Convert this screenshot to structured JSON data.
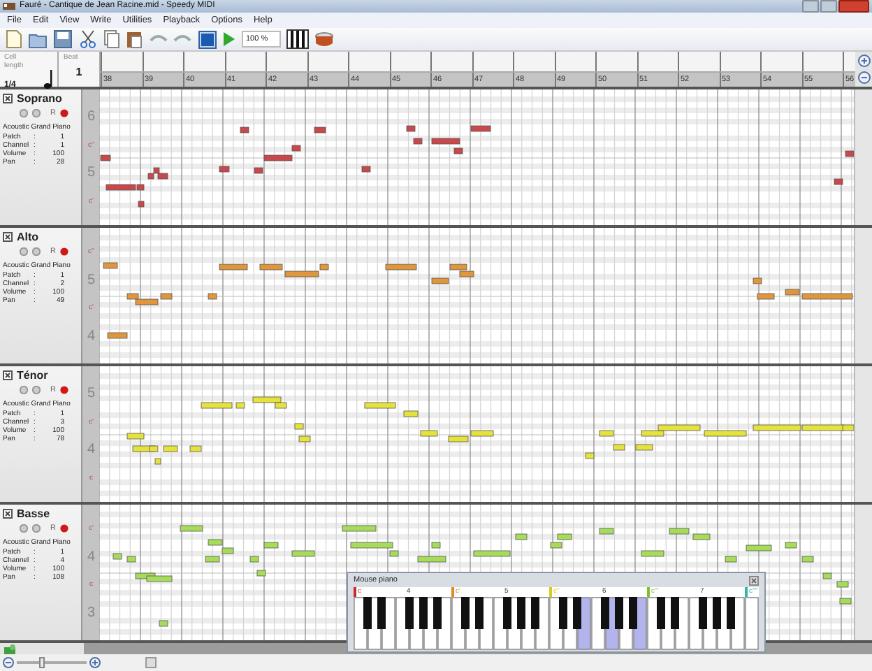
{
  "window": {
    "title": "Fauré - Cantique de Jean Racine.mid - Speedy MIDI"
  },
  "menu": [
    "File",
    "Edit",
    "View",
    "Write",
    "Utilities",
    "Playback",
    "Options",
    "Help"
  ],
  "toolbar": {
    "zoom_value": "100 %",
    "stop_pressed": true
  },
  "header": {
    "cell_label": "Cell length",
    "cell_value": "1/4",
    "beat_label": "Beat",
    "beat_value": "1"
  },
  "measures": [
    "38",
    "39",
    "40",
    "41",
    "42",
    "43",
    "44",
    "45",
    "46",
    "47",
    "48",
    "49",
    "50",
    "51",
    "52",
    "53",
    "54",
    "55",
    "56"
  ],
  "tracks": [
    {
      "name": "Soprano",
      "checked": true,
      "color": "#c8484c",
      "record_label": "R",
      "instrument": "Acoustic Grand Piano",
      "octave_labels": [
        "6",
        "c''",
        "5",
        "c'"
      ],
      "fields": [
        {
          "label": "Patch",
          "sep": ":",
          "value": "1"
        },
        {
          "label": "Channel",
          "sep": ":",
          "value": "1"
        },
        {
          "label": "Volume",
          "sep": ":",
          "value": "100"
        },
        {
          "label": "Pan",
          "sep": ":",
          "value": "28"
        }
      ]
    },
    {
      "name": "Alto",
      "checked": true,
      "color": "#e0963c",
      "record_label": "R",
      "instrument": "Acoustic Grand Piano",
      "octave_labels": [
        "c''",
        "5",
        "c'",
        "4"
      ],
      "fields": [
        {
          "label": "Patch",
          "sep": ":",
          "value": "1"
        },
        {
          "label": "Channel",
          "sep": ":",
          "value": "2"
        },
        {
          "label": "Volume",
          "sep": ":",
          "value": "100"
        },
        {
          "label": "Pan",
          "sep": ":",
          "value": "49"
        }
      ]
    },
    {
      "name": "Ténor",
      "checked": true,
      "color": "#e6e23c",
      "record_label": "R",
      "instrument": "Acoustic Grand Piano",
      "octave_labels": [
        "5",
        "c'",
        "4",
        "c"
      ],
      "fields": [
        {
          "label": "Patch",
          "sep": ":",
          "value": "1"
        },
        {
          "label": "Channel",
          "sep": ":",
          "value": "3"
        },
        {
          "label": "Volume",
          "sep": ":",
          "value": "100"
        },
        {
          "label": "Pan",
          "sep": ":",
          "value": "78"
        }
      ]
    },
    {
      "name": "Basse",
      "checked": true,
      "color": "#a6dc5a",
      "record_label": "R",
      "instrument": "Acoustic Grand Piano",
      "octave_labels": [
        "c'",
        "4",
        "c",
        "3"
      ],
      "fields": [
        {
          "label": "Patch",
          "sep": ":",
          "value": "1"
        },
        {
          "label": "Channel",
          "sep": ":",
          "value": "4"
        },
        {
          "label": "Volume",
          "sep": ":",
          "value": "100"
        },
        {
          "label": "Pan",
          "sep": ":",
          "value": "108"
        }
      ]
    }
  ],
  "mouse_piano": {
    "title": "Mouse piano",
    "labels": [
      {
        "text": "c",
        "color": "#d02828"
      },
      {
        "text": "4"
      },
      {
        "text": "c'",
        "color": "#e08a20"
      },
      {
        "text": "5"
      },
      {
        "text": "c''",
        "color": "#d8cc20"
      },
      {
        "text": "6"
      },
      {
        "text": "c'''",
        "color": "#80c030"
      },
      {
        "text": "7"
      },
      {
        "text": "c''''",
        "color": "#30b8a8"
      }
    ],
    "white_keys": [
      {
        "pressed": false
      },
      {
        "pressed": false
      },
      {
        "pressed": false
      },
      {
        "pressed": false
      },
      {
        "pressed": false
      },
      {
        "pressed": false
      },
      {
        "pressed": false
      },
      {
        "pressed": false
      },
      {
        "pressed": false
      },
      {
        "pressed": false
      },
      {
        "pressed": false
      },
      {
        "pressed": false
      },
      {
        "pressed": false
      },
      {
        "pressed": false
      },
      {
        "pressed": false
      },
      {
        "pressed": false
      },
      {
        "pressed": true
      },
      {
        "pressed": false
      },
      {
        "pressed": true
      },
      {
        "pressed": false
      },
      {
        "pressed": true
      },
      {
        "pressed": false
      },
      {
        "pressed": false
      },
      {
        "pressed": false
      },
      {
        "pressed": false
      },
      {
        "pressed": false
      },
      {
        "pressed": false
      },
      {
        "pressed": false
      },
      {
        "pressed": false
      }
    ]
  },
  "zoom_slider": {
    "level": 0.35
  }
}
